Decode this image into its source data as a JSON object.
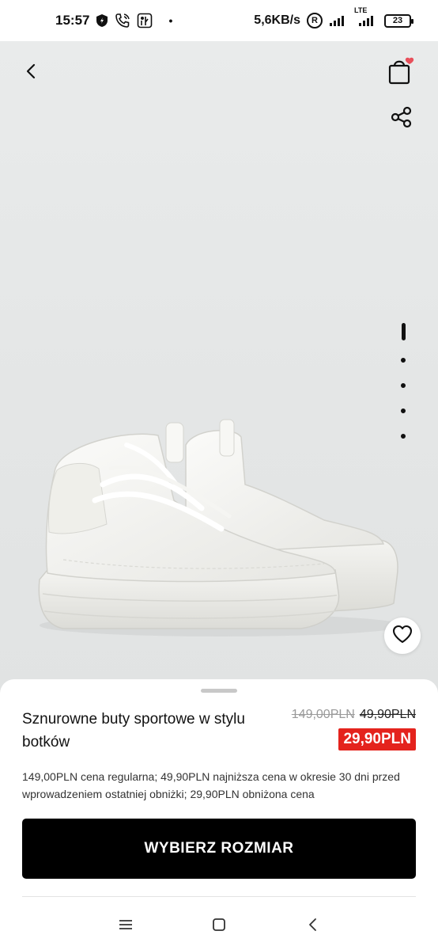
{
  "status_bar": {
    "time": "15:57",
    "network_speed": "5,6KB/s",
    "roaming": "R",
    "network_type": "LTE",
    "battery": "23",
    "dot": "•"
  },
  "header": {
    "back_icon": "chevron-left-icon",
    "bag_icon": "shopping-bag-icon",
    "share_icon": "share-icon",
    "badge_color": "#e8505b"
  },
  "gallery": {
    "pages": 5,
    "current": 1,
    "favorite_icon": "heart-icon"
  },
  "product": {
    "title": "Sznurowne buty sportowe w stylu botków",
    "regular_price": "149,00PLN",
    "lowest_price": "49,90PLN",
    "sale_price": "29,90PLN",
    "disclaimer": "149,00PLN cena regularna; 49,90PLN najniższa cena w okresie 30 dni przed wprowadzeniem ostatniej obniżki; 29,90PLN obniżona cena",
    "sale_color": "#e4231d"
  },
  "actions": {
    "select_size": "WYBIERZ ROZMIAR"
  },
  "navbar": {
    "menu_icon": "menu-icon",
    "home_icon": "square-icon",
    "back_icon": "back-triangle-icon"
  }
}
